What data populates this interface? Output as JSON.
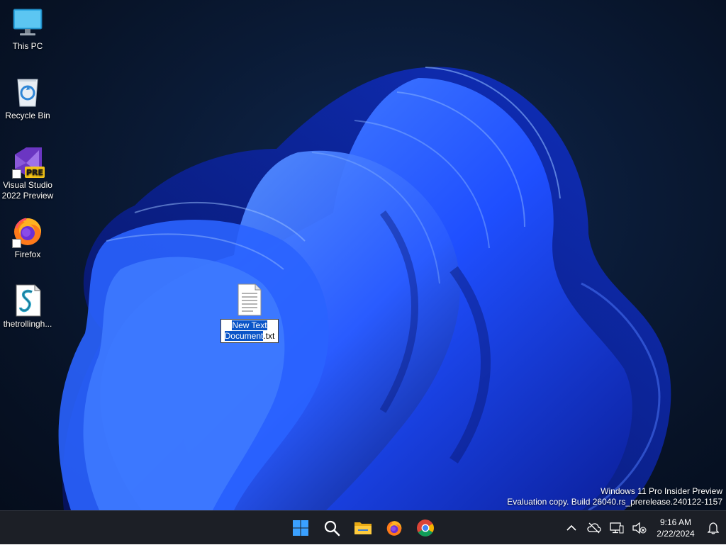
{
  "desktop": {
    "icons": [
      {
        "label": "This PC",
        "icon": "monitor-icon"
      },
      {
        "label": "Recycle Bin",
        "icon": "recycle-bin-icon"
      },
      {
        "label_line1": "Visual Studio",
        "label_line2": "2022 Preview",
        "badge": "PRE",
        "icon": "visual-studio-icon"
      },
      {
        "label": "Firefox",
        "icon": "firefox-icon"
      },
      {
        "label": "thetrollingh...",
        "icon": "script-file-icon"
      }
    ],
    "renaming_file": {
      "selected_text_line1": "New Text",
      "selected_text_line2": "Document",
      "unselected_text": ".txt",
      "icon": "text-document-icon"
    },
    "watermark": {
      "line1": "Windows 11 Pro Insider Preview",
      "line2": "Evaluation copy. Build 26040.rs_prerelease.240122-1157"
    }
  },
  "taskbar": {
    "apps": [
      {
        "name": "Start",
        "icon": "windows-start-icon"
      },
      {
        "name": "Search",
        "icon": "search-icon"
      },
      {
        "name": "File Explorer",
        "icon": "folder-icon"
      },
      {
        "name": "Firefox",
        "icon": "firefox-icon"
      },
      {
        "name": "Chrome",
        "icon": "chrome-icon"
      }
    ],
    "tray": {
      "time": "9:16 AM",
      "date": "2/22/2024"
    }
  },
  "colors": {
    "accent": "#0a55c8",
    "taskbar": "#1c1f26",
    "wallpaper_blue": "#1f4fff"
  }
}
